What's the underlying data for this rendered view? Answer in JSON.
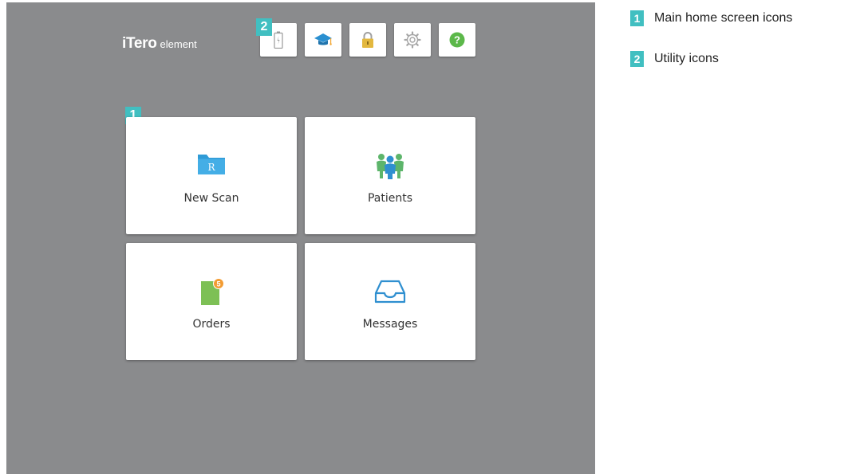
{
  "colors": {
    "screen_bg": "#8a8b8d",
    "callout": "#41bfc1",
    "folder_blue": "#2f9bd6",
    "orders_green": "#7dc055",
    "badge_orange": "#f39c32",
    "help_green": "#5cb84a"
  },
  "logo": {
    "main": "iTero",
    "sub": "element"
  },
  "utility_icons": [
    {
      "name": "battery-icon"
    },
    {
      "name": "graduation-cap-icon"
    },
    {
      "name": "lock-icon"
    },
    {
      "name": "gear-icon"
    },
    {
      "name": "help-icon"
    }
  ],
  "callouts": {
    "main": "1",
    "utility": "2"
  },
  "tiles": {
    "new_scan": {
      "label": "New Scan",
      "icon": "rx-folder-icon",
      "icon_text": "R"
    },
    "patients": {
      "label": "Patients",
      "icon": "patients-icon"
    },
    "orders": {
      "label": "Orders",
      "icon": "orders-icon",
      "badge": "5"
    },
    "messages": {
      "label": "Messages",
      "icon": "inbox-icon"
    }
  },
  "legend": [
    {
      "number": "1",
      "text": "Main home screen icons"
    },
    {
      "number": "2",
      "text": "Utility icons"
    }
  ]
}
